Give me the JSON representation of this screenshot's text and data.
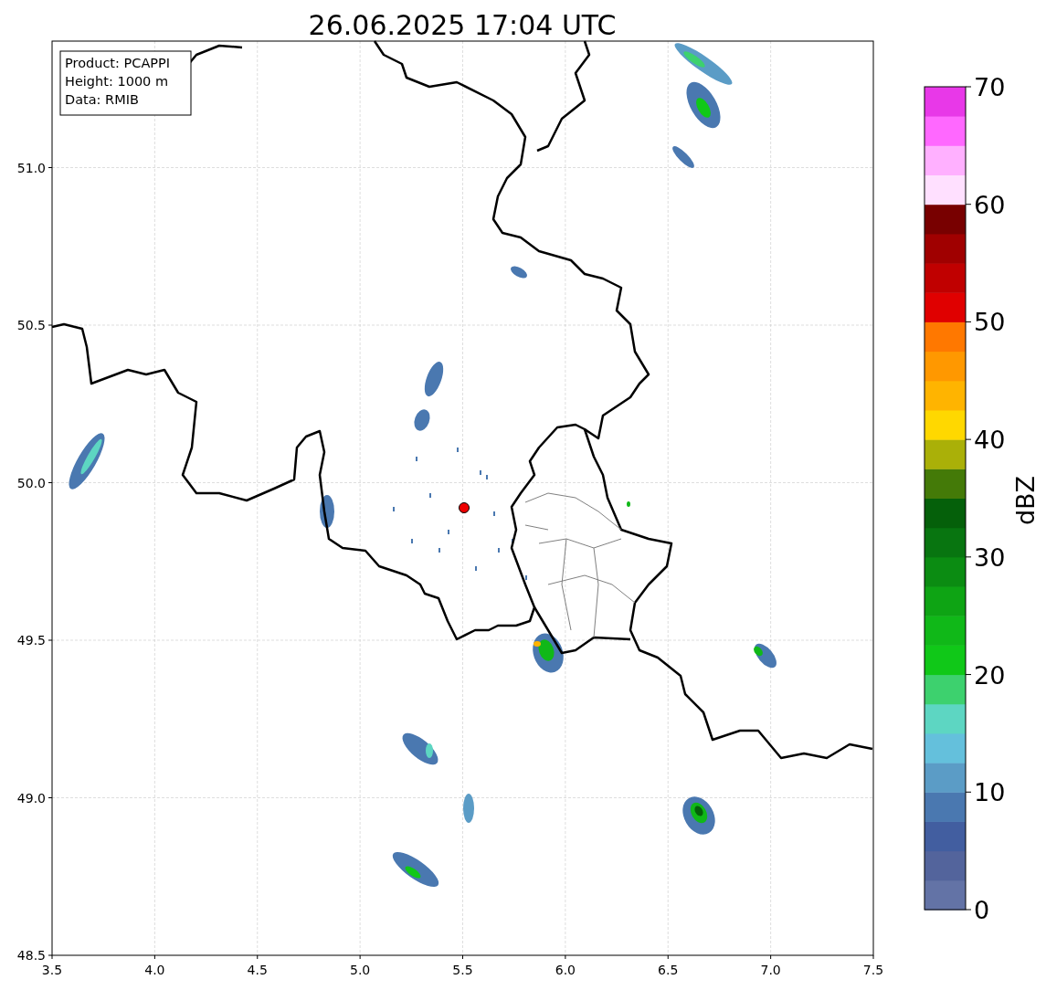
{
  "title": "26.06.2025 17:04 UTC",
  "info_box": [
    "Product: PCAPPI",
    "Height: 1000 m",
    "Data: RMIB"
  ],
  "x_axis": {
    "ticks": [
      "3.5",
      "4.0",
      "4.5",
      "5.0",
      "5.5",
      "6.0",
      "6.5",
      "7.0",
      "7.5"
    ]
  },
  "y_axis": {
    "ticks": [
      "51.0",
      "50.5",
      "50.0",
      "49.5",
      "49.0",
      "48.5"
    ]
  },
  "colorbar": {
    "label": "dBZ",
    "ticks": [
      "70",
      "60",
      "50",
      "40",
      "30",
      "20",
      "10",
      "0"
    ],
    "levels": [
      {
        "color": "#6373a6"
      },
      {
        "color": "#53649c"
      },
      {
        "color": "#425ea0"
      },
      {
        "color": "#4a78b0"
      },
      {
        "color": "#5b9cc6"
      },
      {
        "color": "#64c0dc"
      },
      {
        "color": "#5dd6c2"
      },
      {
        "color": "#3dd16e"
      },
      {
        "color": "#10c818"
      },
      {
        "color": "#10b818"
      },
      {
        "color": "#0ea414"
      },
      {
        "color": "#0b8c12"
      },
      {
        "color": "#087510"
      },
      {
        "color": "#05600a"
      },
      {
        "color": "#447a08"
      },
      {
        "color": "#aab008"
      },
      {
        "color": "#ffd800"
      },
      {
        "color": "#ffb400"
      },
      {
        "color": "#ff9800"
      },
      {
        "color": "#ff7800"
      },
      {
        "color": "#e00000"
      },
      {
        "color": "#c00000"
      },
      {
        "color": "#a00000"
      },
      {
        "color": "#780000"
      },
      {
        "color": "#ffe0ff"
      },
      {
        "color": "#ffb0ff"
      },
      {
        "color": "#ff68ff"
      },
      {
        "color": "#e838e8"
      }
    ]
  }
}
